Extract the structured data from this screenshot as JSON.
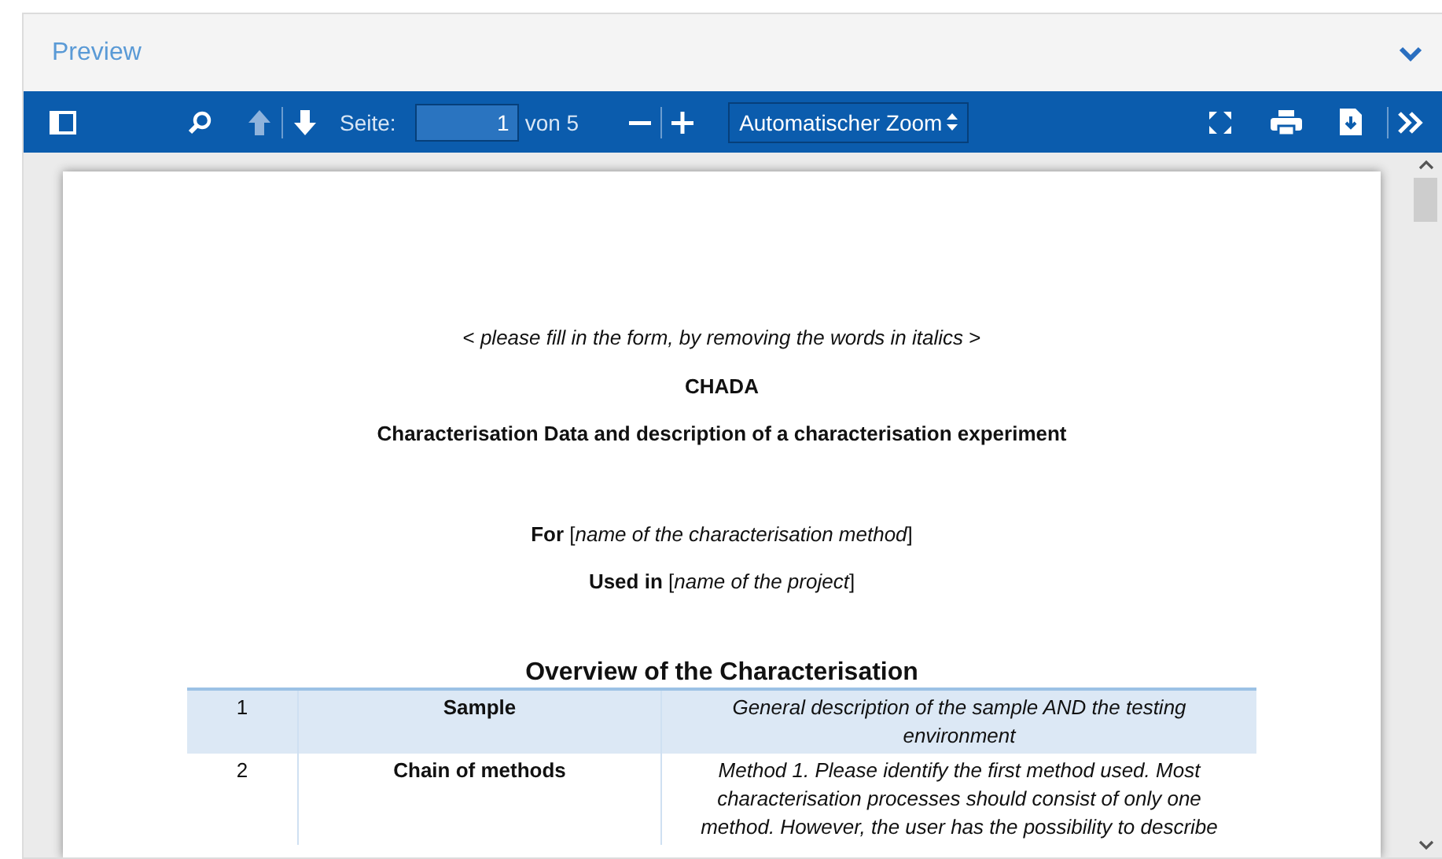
{
  "panel": {
    "title": "Preview",
    "expanded": true
  },
  "toolbar": {
    "page_label": "Seite:",
    "page_value": "1",
    "page_total": "von 5",
    "zoom": "Automatischer Zoom"
  },
  "document": {
    "lines": [
      {
        "text": "< *please fill in the form, by removing the words in italics* >",
        "kind": "plain"
      },
      {
        "text": "CHADA",
        "kind": "bold"
      },
      {
        "text": "Characterisation Data and description of a characterisation experiment",
        "kind": "bold"
      },
      {
        "text": "**For** [*name of the characterisation method*]",
        "kind": "spaced"
      },
      {
        "text": "**Used in** [*name of the project*]",
        "kind": "plain"
      }
    ],
    "table_title": "Overview of the Characterisation",
    "rows": [
      {
        "cells": [
          "1",
          "Sample",
          "General description of the sample AND the testing environment"
        ],
        "shaded": true
      },
      {
        "cells": [
          "2",
          "Chain of methods",
          "Method 1. Please identify the first method used. Most characterisation processes should consist of only one method. However, the user has the possibility to describe"
        ],
        "shaded": false
      }
    ]
  }
}
